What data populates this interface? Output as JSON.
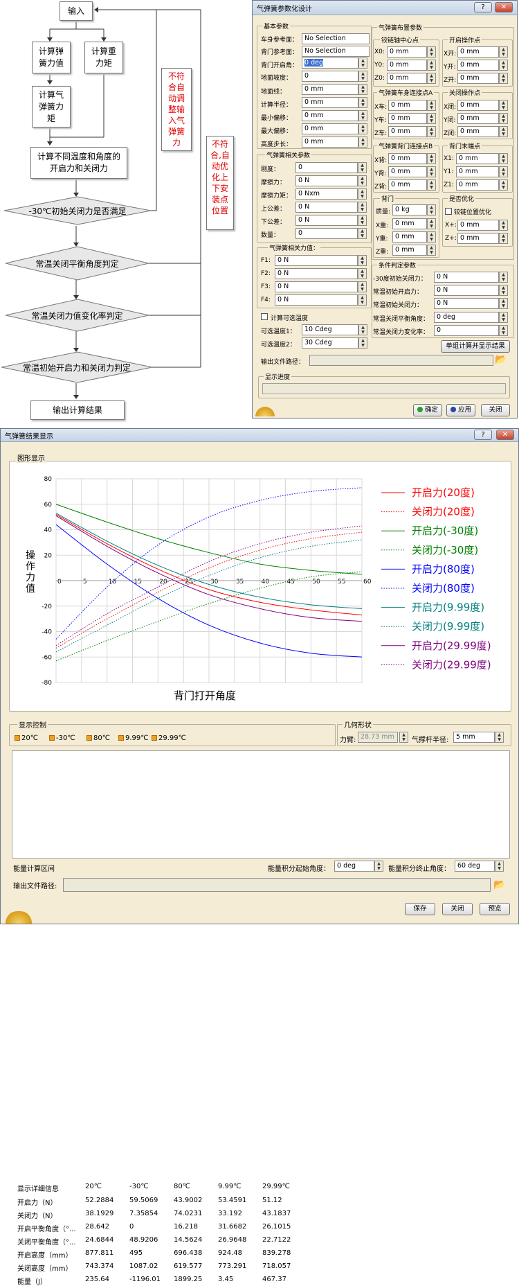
{
  "flowchart": {
    "input": "输入",
    "spring_force": "计算弹簧力值",
    "gravity_moment": "计算重力矩",
    "spring_moment": "计算气弹簧力矩",
    "open_close_force": "计算不同温度和角度的开启力和关闭力",
    "check_minus30": "-30℃初始关闭力是否满足",
    "check_balance": "常温关闭平衡角度判定",
    "check_rate": "常温关闭力值变化率判定",
    "check_initial": "常温初始开启力和关闭力判定",
    "output": "输出计算结果",
    "fail_1": "不符合自动调整输入气弹簧力",
    "fail_2": "不符合,自动优化上下安装点位置"
  },
  "design_window": {
    "title": "气弹簧参数化设计",
    "basic": {
      "group": "基本参数",
      "body_ref_label": "车身参考面：",
      "body_ref": "No Selection",
      "door_ref_label": "背门参考面：",
      "door_ref": "No Selection",
      "open_angle_label": "背门开启角：",
      "open_angle": "0 deg",
      "ground_slope_label": "地面坡度：",
      "ground_slope": "0",
      "ground_line_label": "地面线：",
      "ground_line": "0 mm",
      "radius_label": "计算半径：",
      "radius": "0 mm",
      "min_offset_label": "最小偏移：",
      "min_offset": "0 mm",
      "max_offset_label": "最大偏移：",
      "max_offset": "0 mm",
      "height_step_label": "高度步长：",
      "height_step": "0 mm"
    },
    "spring": {
      "group": "气弹簧相关参数",
      "rows": [
        {
          "label": "刚度：",
          "value": "0"
        },
        {
          "label": "摩擦力：",
          "value": "0 N"
        },
        {
          "label": "摩擦力矩：",
          "value": "0 Nxm"
        },
        {
          "label": "上公差：",
          "value": "0 N"
        },
        {
          "label": "下公差：",
          "value": "0 N"
        },
        {
          "label": "数量：",
          "value": "0"
        }
      ]
    },
    "force": {
      "group": "气弹簧相关力值：",
      "rows": [
        {
          "label": "F1:",
          "value": "0 N"
        },
        {
          "label": "F2:",
          "value": "0 N"
        },
        {
          "label": "F3:",
          "value": "0 N"
        },
        {
          "label": "F4:",
          "value": "0 N"
        }
      ]
    },
    "temp": {
      "checkbox": "计算可选温度",
      "t1_label": "可选温度1：",
      "t1": "10 Cdeg",
      "t2_label": "可选温度2：",
      "t2": "30 Cdeg"
    },
    "layout": {
      "group": "气弹簧布置参数",
      "hinge": {
        "group": "铰链轴中心点",
        "rows": [
          {
            "label": "X0:",
            "value": "0 mm"
          },
          {
            "label": "Y0:",
            "value": "0 mm"
          },
          {
            "label": "Z0:",
            "value": "0 mm"
          }
        ]
      },
      "open_point": {
        "group": "开启操作点",
        "rows": [
          {
            "label": "X开:",
            "value": "0 mm"
          },
          {
            "label": "Y开:",
            "value": "0 mm"
          },
          {
            "label": "Z开:",
            "value": "0 mm"
          }
        ]
      },
      "body_point": {
        "group": "气弹簧车身连接点A",
        "rows": [
          {
            "label": "X车:",
            "value": "0 mm"
          },
          {
            "label": "Y车:",
            "value": "0 mm"
          },
          {
            "label": "Z车:",
            "value": "0 mm"
          }
        ]
      },
      "close_point": {
        "group": "关闭操作点",
        "rows": [
          {
            "label": "X闭:",
            "value": "0 mm"
          },
          {
            "label": "Y闭:",
            "value": "0 mm"
          },
          {
            "label": "Z闭:",
            "value": "0 mm"
          }
        ]
      },
      "door_point": {
        "group": "气弹簧背门连接点B",
        "rows": [
          {
            "label": "X背:",
            "value": "0 mm"
          },
          {
            "label": "Y背:",
            "value": "0 mm"
          },
          {
            "label": "Z背:",
            "value": "0 mm"
          }
        ]
      },
      "end_point": {
        "group": "背门末端点",
        "rows": [
          {
            "label": "X1:",
            "value": "0 mm"
          },
          {
            "label": "Y1:",
            "value": "0 mm"
          },
          {
            "label": "Z1:",
            "value": "0 mm"
          }
        ]
      },
      "door": {
        "group": "背门",
        "rows": [
          {
            "label": "质量:",
            "value": "0 kg"
          },
          {
            "label": "X重:",
            "value": "0 mm"
          },
          {
            "label": "Y重:",
            "value": "0 mm"
          },
          {
            "label": "Z重:",
            "value": "0 mm"
          }
        ]
      },
      "optimize": {
        "group": "是否优化",
        "checkbox": "铰链位置优化",
        "rows": [
          {
            "label": "X+:",
            "value": "0 mm"
          },
          {
            "label": "Z+:",
            "value": "0 mm"
          }
        ]
      }
    },
    "conditions": {
      "group": "条件判定参数",
      "rows": [
        {
          "label": "-30度初始关闭力：",
          "value": "0 N"
        },
        {
          "label": "常温初始开启力：",
          "value": "0 N"
        },
        {
          "label": "常温初始关闭力：",
          "value": "0 N"
        },
        {
          "label": "常温关闭平衡角度：",
          "value": "0 deg"
        },
        {
          "label": "常温关闭力变化率：",
          "value": "0"
        }
      ],
      "calc_button": "单组计算并显示结果"
    },
    "output_path_label": "输出文件路径：",
    "progress_group": "显示进度",
    "ok_button": "确定",
    "apply_button": "应用",
    "close_button": "关闭"
  },
  "result_window": {
    "title": "气弹簧结果显示",
    "graph_group": "图形显示",
    "display_group": "显示控制",
    "temps": [
      "20℃",
      "-30℃",
      "80℃",
      "9.99℃",
      "29.99℃"
    ],
    "geometry_group": "几何形状",
    "arm_label": "力臂:",
    "arm_value": "28.73 mm",
    "radius_label": "气撑杆半径:",
    "radius_value": "5 mm",
    "table": {
      "headers": [
        "显示详细信息",
        "20℃",
        "-30℃",
        "80℃",
        "9.99℃",
        "29.99℃"
      ],
      "rows": [
        [
          "开启力（N）",
          "52.2884",
          "59.5069",
          "43.9002",
          "53.4591",
          "51.12"
        ],
        [
          "关闭力（N）",
          "38.1929",
          "7.35854",
          "74.0231",
          "33.192",
          "43.1837"
        ],
        [
          "开启平衡角度（°...",
          "28.642",
          "0",
          "16.218",
          "31.6682",
          "26.1015"
        ],
        [
          "关闭平衡角度（°...",
          "24.6844",
          "48.9206",
          "14.5624",
          "26.9648",
          "22.7122"
        ],
        [
          "开启高度（mm）",
          "877.811",
          "495",
          "696.438",
          "924.48",
          "839.278"
        ],
        [
          "关闭高度（mm）",
          "743.374",
          "1087.02",
          "619.577",
          "773.291",
          "718.057"
        ],
        [
          "能量（J）",
          "235.64",
          "-1196.01",
          "1899.25",
          "3.45",
          "467.37"
        ]
      ]
    },
    "energy_label": "能量计算区间",
    "energy_start_label": "能量积分起始角度：",
    "energy_start": "0 deg",
    "energy_end_label": "能量积分终止角度：",
    "energy_end": "60 deg",
    "output_path_label": "输出文件路径:",
    "save_button": "保存",
    "close_button": "关闭",
    "preview_button": "预览"
  },
  "chart_data": {
    "type": "line",
    "xlabel": "背门打开角度",
    "ylabel": "操作力值",
    "xlim": [
      0,
      60
    ],
    "ylim": [
      -80,
      80
    ],
    "xticks": [
      0,
      5,
      10,
      15,
      20,
      25,
      30,
      35,
      40,
      45,
      50,
      55,
      60
    ],
    "yticks": [
      80,
      60,
      40,
      20,
      -20,
      -40,
      -60,
      -80
    ],
    "x": [
      0,
      10,
      20,
      30,
      40,
      50,
      60
    ],
    "legend_position": "right",
    "series": [
      {
        "name": "开启力(20度)",
        "style": "solid",
        "color": "#ff0000",
        "values": [
          52,
          29,
          9,
          -7,
          -17,
          -23,
          -27
        ]
      },
      {
        "name": "关闭力(20度)",
        "style": "dotted",
        "color": "#ff0000",
        "values": [
          -53,
          -30,
          -9,
          10,
          24,
          33,
          38
        ]
      },
      {
        "name": "开启力(-30度)",
        "style": "solid",
        "color": "#008000",
        "values": [
          60,
          46,
          33,
          22,
          13,
          8,
          5
        ]
      },
      {
        "name": "关闭力(-30度)",
        "style": "dotted",
        "color": "#008000",
        "values": [
          -63,
          -47,
          -32,
          -18,
          -6,
          3,
          7
        ]
      },
      {
        "name": "开启力(80度)",
        "style": "solid",
        "color": "#0000ff",
        "values": [
          44,
          13,
          -14,
          -35,
          -49,
          -57,
          -60
        ]
      },
      {
        "name": "关闭力(80度)",
        "style": "dotted",
        "color": "#0000ff",
        "values": [
          -46,
          -5,
          28,
          50,
          63,
          70,
          73
        ]
      },
      {
        "name": "开启力(9.99度)",
        "style": "solid",
        "color": "#008080",
        "values": [
          53,
          31,
          12,
          -3,
          -13,
          -19,
          -22
        ]
      },
      {
        "name": "关闭力(9.99度)",
        "style": "dotted",
        "color": "#008080",
        "values": [
          -56,
          -35,
          -14,
          4,
          18,
          27,
          32
        ]
      },
      {
        "name": "开启力(29.99度)",
        "style": "solid",
        "color": "#800080",
        "values": [
          51,
          27,
          6,
          -11,
          -22,
          -29,
          -32
        ]
      },
      {
        "name": "关闭力(29.99度)",
        "style": "dotted",
        "color": "#800080",
        "values": [
          -51,
          -26,
          -5,
          15,
          29,
          38,
          43
        ]
      }
    ]
  }
}
